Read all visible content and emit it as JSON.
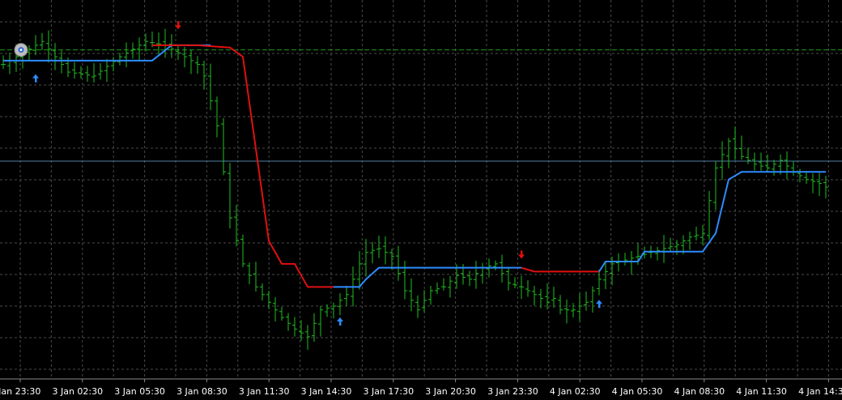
{
  "chart_data": {
    "type": "bar",
    "title": "",
    "xlabel": "",
    "ylabel": "",
    "grid": true,
    "colors": {
      "background": "#000000",
      "grid": "#4a4a4a",
      "bars": "#1fbf1f",
      "trail_up": "#2e8bff",
      "trail_down": "#e01010",
      "level_line": "#1e9a1e",
      "h_line": "#4f7fa6",
      "axis_text": "#ffffff"
    },
    "x_tick_labels": [
      "3 Jan 23:30",
      "3 Jan 02:30",
      "3 Jan 05:30",
      "3 Jan 08:30",
      "3 Jan 11:30",
      "3 Jan 14:30",
      "3 Jan 17:30",
      "3 Jan 20:30",
      "3 Jan 23:30",
      "4 Jan 02:30",
      "4 Jan 05:30",
      "4 Jan 08:30",
      "4 Jan 11:30",
      "4 Jan 14:30"
    ],
    "ylim": [
      0,
      494
    ],
    "level_line": 429,
    "h_line": 284,
    "ohlc_keypoints": [
      [
        0,
        410
      ],
      [
        3,
        425
      ],
      [
        6,
        440
      ],
      [
        10,
        400
      ],
      [
        14,
        395
      ],
      [
        18,
        420
      ],
      [
        22,
        440
      ],
      [
        25,
        435
      ],
      [
        28,
        420
      ],
      [
        30,
        410
      ],
      [
        31,
        395
      ],
      [
        33,
        330
      ],
      [
        35,
        210
      ],
      [
        37,
        150
      ],
      [
        39,
        120
      ],
      [
        41,
        100
      ],
      [
        43,
        80
      ],
      [
        45,
        65
      ],
      [
        47,
        55
      ],
      [
        49,
        90
      ],
      [
        51,
        95
      ],
      [
        53,
        110
      ],
      [
        55,
        150
      ],
      [
        56,
        165
      ],
      [
        58,
        170
      ],
      [
        60,
        160
      ],
      [
        62,
        115
      ],
      [
        64,
        90
      ],
      [
        66,
        115
      ],
      [
        68,
        120
      ],
      [
        70,
        135
      ],
      [
        72,
        130
      ],
      [
        74,
        145
      ],
      [
        76,
        150
      ],
      [
        78,
        125
      ],
      [
        80,
        120
      ],
      [
        82,
        110
      ],
      [
        84,
        100
      ],
      [
        85,
        105
      ],
      [
        86,
        90
      ],
      [
        88,
        90
      ],
      [
        90,
        100
      ],
      [
        92,
        130
      ],
      [
        94,
        150
      ],
      [
        96,
        155
      ],
      [
        98,
        160
      ],
      [
        100,
        165
      ],
      [
        102,
        170
      ],
      [
        104,
        175
      ],
      [
        106,
        185
      ],
      [
        108,
        190
      ],
      [
        110,
        275
      ],
      [
        112,
        310
      ],
      [
        114,
        290
      ],
      [
        116,
        280
      ],
      [
        118,
        275
      ],
      [
        120,
        285
      ],
      [
        122,
        270
      ],
      [
        124,
        260
      ],
      [
        126,
        255
      ],
      [
        127,
        250
      ]
    ],
    "trail_segments": [
      {
        "color": "up",
        "points": [
          [
            0,
            415
          ],
          [
            15,
            415
          ],
          [
            23,
            415
          ],
          [
            26,
            435
          ],
          [
            32,
            435
          ]
        ]
      },
      {
        "color": "down",
        "points": [
          [
            23,
            435
          ],
          [
            30,
            435
          ],
          [
            35,
            432
          ],
          [
            37,
            420
          ],
          [
            39,
            300
          ],
          [
            41,
            180
          ],
          [
            43,
            150
          ],
          [
            45,
            150
          ],
          [
            47,
            120
          ],
          [
            51,
            120
          ]
        ]
      },
      {
        "color": "up",
        "points": [
          [
            51,
            120
          ],
          [
            55,
            120
          ],
          [
            56,
            130
          ],
          [
            58,
            145
          ],
          [
            62,
            145
          ],
          [
            68,
            145
          ],
          [
            74,
            145
          ],
          [
            80,
            145
          ]
        ]
      },
      {
        "color": "down",
        "points": [
          [
            80,
            145
          ],
          [
            82,
            140
          ],
          [
            92,
            140
          ]
        ]
      },
      {
        "color": "up",
        "points": [
          [
            92,
            140
          ],
          [
            93,
            153
          ],
          [
            98,
            153
          ],
          [
            99,
            166
          ],
          [
            108,
            166
          ],
          [
            110,
            190
          ],
          [
            112,
            260
          ],
          [
            114,
            270
          ],
          [
            120,
            270
          ],
          [
            127,
            270
          ]
        ]
      }
    ],
    "signals": [
      {
        "dir": "down",
        "bar": 27,
        "y": 460
      },
      {
        "dir": "up",
        "bar": 5,
        "y": 393
      },
      {
        "dir": "up",
        "bar": 52,
        "y": 76
      },
      {
        "dir": "down",
        "bar": 80,
        "y": 161
      },
      {
        "dir": "up",
        "bar": 92,
        "y": 99
      }
    ],
    "marker_bar": 3
  }
}
